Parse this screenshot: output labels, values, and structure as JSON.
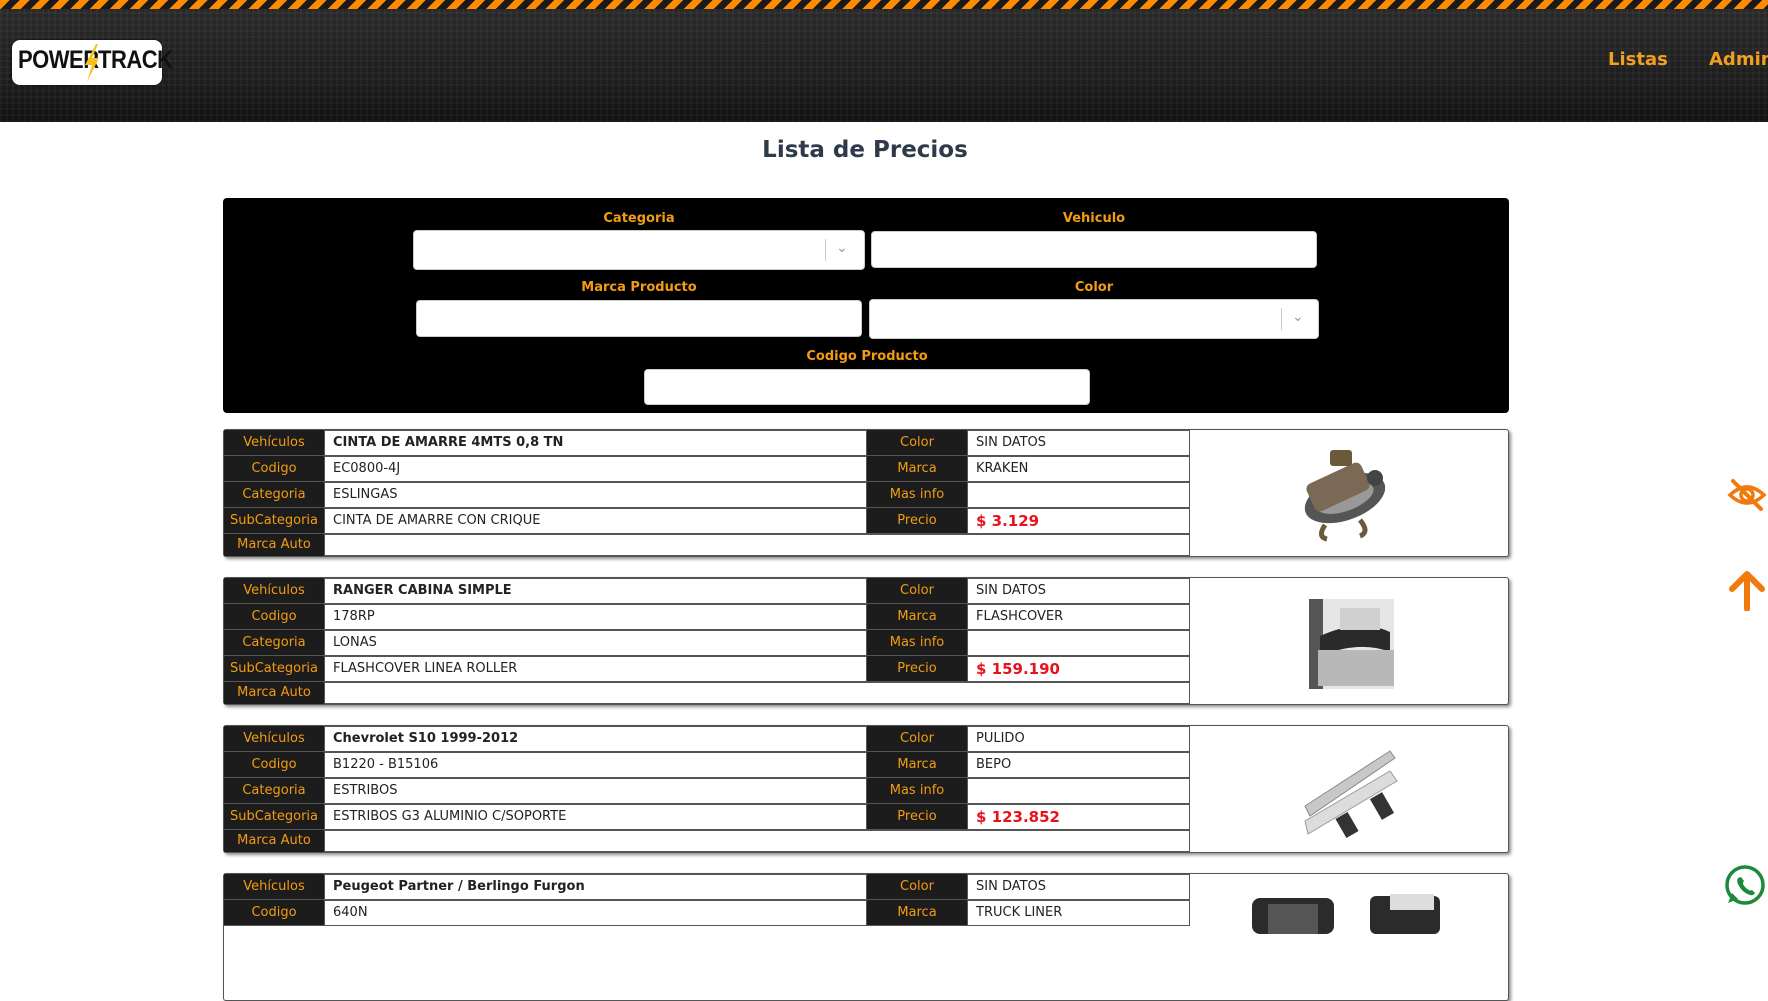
{
  "header": {
    "logo_left": "POWER",
    "logo_right": "TRACK",
    "nav": [
      "Listas",
      "Admin"
    ]
  },
  "page": {
    "title": "Lista de Precios"
  },
  "filters": {
    "categoria_label": "Categoria",
    "vehiculo_label": "Vehiculo",
    "marca_producto_label": "Marca Producto",
    "color_label": "Color",
    "codigo_producto_label": "Codigo Producto",
    "categoria_value": "",
    "vehiculo_value": "",
    "marca_producto_value": "",
    "color_value": "",
    "codigo_producto_value": ""
  },
  "labels": {
    "vehiculos": "Vehículos",
    "codigo": "Codigo",
    "categoria": "Categoria",
    "subcategoria": "SubCategoria",
    "marca_auto": "Marca Auto",
    "color": "Color",
    "marca": "Marca",
    "mas_info": "Mas info",
    "precio": "Precio"
  },
  "products": [
    {
      "vehiculos": "CINTA DE AMARRE 4MTS 0,8 TN",
      "codigo": "EC0800-4J",
      "categoria": "ESLINGAS",
      "subcategoria": "CINTA DE AMARRE CON CRIQUE",
      "marca_auto": "",
      "color": "SIN DATOS",
      "marca": "KRAKEN",
      "mas_info": "",
      "precio": "$ 3.129",
      "image": "ratchet-strap-image"
    },
    {
      "vehiculos": "RANGER CABINA SIMPLE",
      "codigo": "178RP",
      "categoria": "LONAS",
      "subcategoria": "FLASHCOVER LINEA ROLLER",
      "marca_auto": "",
      "color": "SIN DATOS",
      "marca": "FLASHCOVER",
      "mas_info": "",
      "precio": "$ 159.190",
      "image": "tonneau-cover-image"
    },
    {
      "vehiculos": "Chevrolet S10 1999-2012",
      "codigo": "B1220 - B15106",
      "categoria": "ESTRIBOS",
      "subcategoria": "ESTRIBOS G3 ALUMINIO C/SOPORTE",
      "marca_auto": "",
      "color": "PULIDO",
      "marca": "BEPO",
      "mas_info": "",
      "precio": "$ 123.852",
      "image": "running-board-image"
    },
    {
      "vehiculos": "Peugeot Partner / Berlingo Furgon",
      "codigo": "640N",
      "color": "SIN DATOS",
      "marca": "TRUCK LINER",
      "image": "truck-liner-image"
    }
  ],
  "side_icons": [
    "eye-slash-icon",
    "arrow-up-icon",
    "whatsapp-icon"
  ],
  "colors": {
    "accent": "#f39c12",
    "price": "#e8121d",
    "dark": "#1c1c1c"
  }
}
